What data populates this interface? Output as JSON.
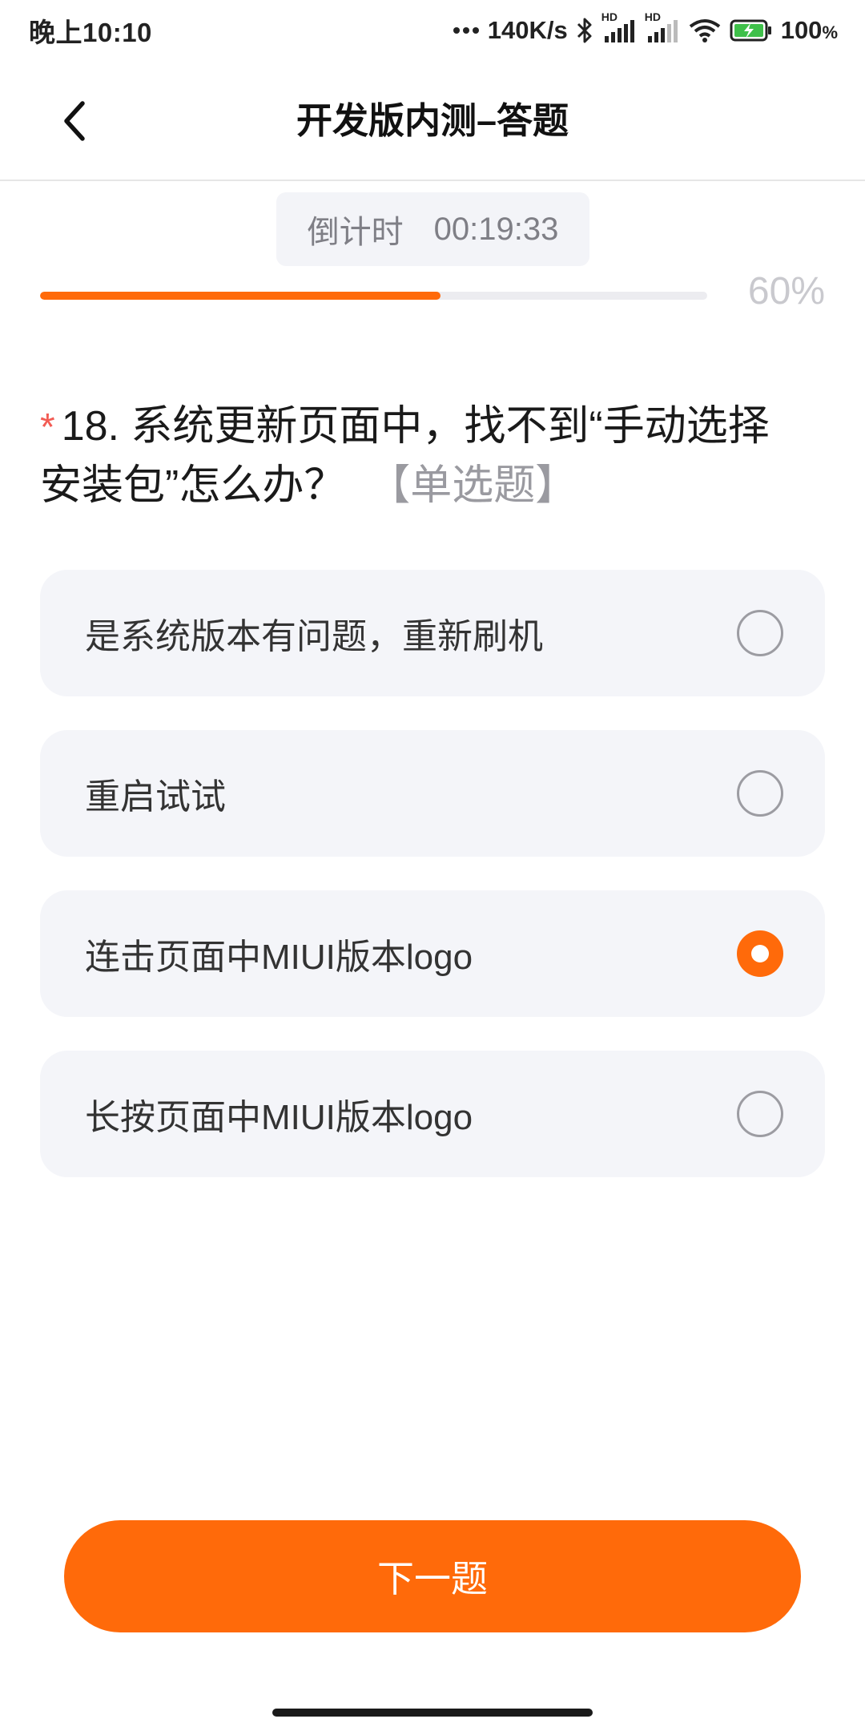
{
  "status_bar": {
    "time": "晚上10:10",
    "net_speed": "140K/s",
    "network_label_1": "HD",
    "network_label_2": "HD",
    "battery": "100",
    "battery_unit": "%"
  },
  "nav": {
    "back_icon": "chevron-left-icon",
    "title": "开发版内测–答题"
  },
  "timer": {
    "label": "倒计时",
    "value": "00:19:33"
  },
  "progress": {
    "percent_value": 60,
    "percent_text": "60%",
    "color": "#ff6a0a"
  },
  "question": {
    "required_mark": "*",
    "text": "18. 系统更新页面中，找不到“手动选择安装包”怎么办？",
    "type_label": "【单选题】"
  },
  "options": [
    {
      "label": "是系统版本有问题，重新刷机",
      "selected": false
    },
    {
      "label": "重启试试",
      "selected": false
    },
    {
      "label": "连击页面中MIUI版本logo",
      "selected": true
    },
    {
      "label": "长按页面中MIUI版本logo",
      "selected": false
    }
  ],
  "footer": {
    "next_label": "下一题"
  },
  "colors": {
    "accent": "#ff6a0a",
    "required": "#f25c54",
    "option_bg": "#f4f5f9"
  }
}
